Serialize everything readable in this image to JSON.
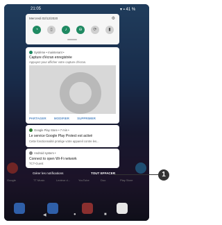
{
  "status_bar": {
    "time": "21:05",
    "battery": "41 %"
  },
  "quick_settings": {
    "date": "Mercredi 02/12/2020",
    "tiles": [
      "wifi-icon",
      "vibrate-icon",
      "notifications-icon",
      "dnd-icon",
      "rotate-icon",
      "battery-saver-icon"
    ]
  },
  "notifications": [
    {
      "app": "Système • maintenant •",
      "title": "Capture d'écran enregistrée",
      "text": "Appuyez pour afficher votre capture d'écran.",
      "actions": [
        "PARTAGER",
        "MODIFIER",
        "SUPPRIMER"
      ]
    },
    {
      "app": "Google Play Store • 7 min •",
      "title": "Le service Google Play Protect est activé",
      "text": "Cette fonctionnalité protège votre appareil contre les..."
    },
    {
      "app": "Android system •",
      "title": "Connect to open Wi-Fi network",
      "text": "TCT-Guest"
    }
  ],
  "footer": {
    "manage": "Gérer les notifications",
    "clear_all": "TOUT EFFACER"
  },
  "homescreen_labels": [
    "Google",
    "TT Music",
    "Lecteur d...",
    "YouTube",
    "Duo",
    "Play Store"
  ],
  "callout": {
    "number": "1"
  },
  "colors": {
    "accent": "#1f8a62",
    "link": "#5b8fc8",
    "google_play": "#2e7d32"
  }
}
